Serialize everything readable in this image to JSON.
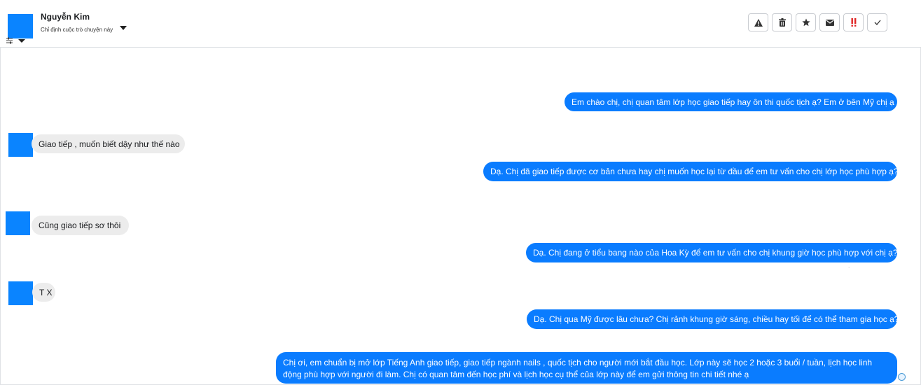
{
  "header": {
    "contact_name": "Nguyễn Kim",
    "assign_label": "Chỉ định cuộc trò chuyện này",
    "actions": [
      {
        "icon": "warning-icon",
        "label": "report"
      },
      {
        "icon": "trash-icon",
        "label": "delete"
      },
      {
        "icon": "star-icon",
        "label": "star"
      },
      {
        "icon": "envelope-icon",
        "label": "mark-unread"
      },
      {
        "icon": "double-exclamation-icon",
        "label": "important"
      },
      {
        "icon": "check-icon",
        "label": "done"
      }
    ]
  },
  "colors": {
    "outgoing_bubble": "#0a7cff",
    "incoming_bubble": "#ececec",
    "avatar": "#0a84ff",
    "important_icon": "#e02424"
  },
  "messages": [
    {
      "direction": "outgoing",
      "text": "Em chào chị, chị quan tâm lớp học giao tiếp hay ôn thi quốc tịch ạ? Em ở bên Mỹ chị ạ"
    },
    {
      "direction": "incoming",
      "text": "Giao tiếp , muốn biết dậy như thế nào"
    },
    {
      "direction": "outgoing",
      "text": "Dạ. Chị đã giao tiếp được cơ bản chưa hay chị muốn học lại từ đầu để em tư vấn cho chị lớp học phù hợp ạ?"
    },
    {
      "direction": "incoming",
      "text": "Cũng  giao tiếp sơ thôi"
    },
    {
      "direction": "outgoing",
      "text": "Dạ. Chị đang ở tiểu bang nào của Hoa Kỳ để em tư vấn cho chị khung giờ học phù hợp với chị ạ?"
    },
    {
      "direction": "incoming",
      "text": "T X"
    },
    {
      "direction": "outgoing",
      "text": "Dạ. Chị qua Mỹ được lâu chưa? Chị rảnh khung giờ sáng, chiều hay tối để có thể tham gia học ạ?"
    },
    {
      "direction": "outgoing",
      "text": "Chị ơi, em chuẩn bị mở lớp Tiếng Anh giao tiếp, giao tiếp ngành nails , quốc tịch cho người mới bắt đầu học. Lớp này sẽ học 2 hoặc 3 buổi / tuần, lịch học linh động phù hợp với người đi làm. Chị có quan tâm đến học phí và lịch học cụ thể của lớp này để em  gửi thông tin chi tiết nhé ạ"
    }
  ]
}
